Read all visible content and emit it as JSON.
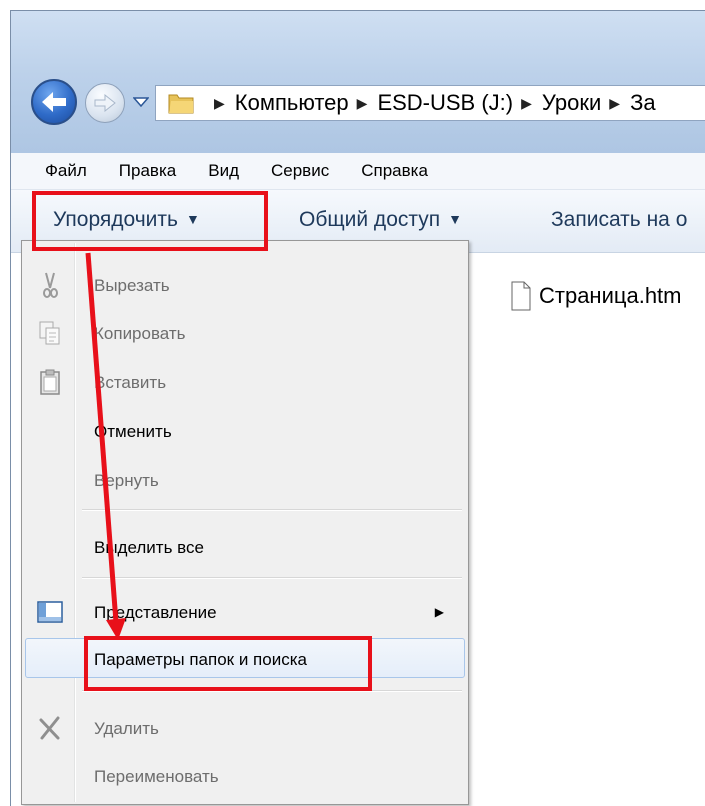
{
  "address": {
    "crumbs": [
      "Компьютер",
      "ESD-USB (J:)",
      "Уроки",
      "За"
    ]
  },
  "menubar": {
    "items": [
      "Файл",
      "Правка",
      "Вид",
      "Сервис",
      "Справка"
    ]
  },
  "toolbar": {
    "organize_label": "Упорядочить",
    "share_label": "Общий доступ",
    "burn_label": "Записать на о"
  },
  "file": {
    "name": "Страница.htm"
  },
  "context_menu": {
    "items": [
      {
        "label": "Вырезать",
        "enabled": false,
        "icon": "scissors-icon"
      },
      {
        "label": "Копировать",
        "enabled": false,
        "icon": "copy-icon"
      },
      {
        "label": "Вставить",
        "enabled": false,
        "icon": "paste-icon"
      },
      {
        "label": "Отменить",
        "enabled": true
      },
      {
        "label": "Вернуть",
        "enabled": false
      },
      {
        "label": "Выделить все",
        "enabled": true
      },
      {
        "label": "Представление",
        "enabled": true,
        "icon": "layout-icon",
        "submenu": true
      },
      {
        "label": "Параметры папок и поиска",
        "enabled": true,
        "highlighted": true
      },
      {
        "label": "Удалить",
        "enabled": false,
        "icon": "delete-icon"
      },
      {
        "label": "Переименовать",
        "enabled": false
      }
    ]
  },
  "annotation": {
    "highlight_color": "#e8101a"
  }
}
